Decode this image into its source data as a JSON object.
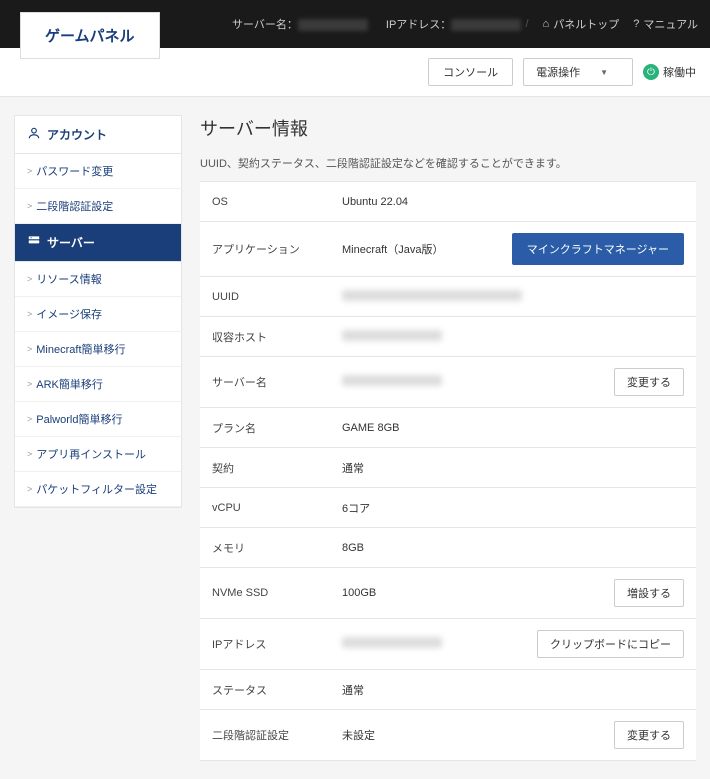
{
  "brand": "ゲームパネル",
  "topbar": {
    "server_name_label": "サーバー名：",
    "ip_label": "IPアドレス：",
    "panel_top": "パネルトップ",
    "manual": "マニュアル"
  },
  "actionbar": {
    "console": "コンソール",
    "power": "電源操作",
    "status": "稼働中"
  },
  "sidebar": {
    "sections": [
      {
        "title": "アカウント",
        "icon": "user",
        "active": false,
        "items": [
          {
            "label": "パスワード変更"
          },
          {
            "label": "二段階認証設定"
          }
        ]
      },
      {
        "title": "サーバー",
        "icon": "server",
        "active": true,
        "items": [
          {
            "label": "リソース情報"
          },
          {
            "label": "イメージ保存"
          },
          {
            "label": "Minecraft簡単移行"
          },
          {
            "label": "ARK簡単移行"
          },
          {
            "label": "Palworld簡単移行"
          },
          {
            "label": "アプリ再インストール"
          },
          {
            "label": "パケットフィルター設定"
          }
        ]
      }
    ]
  },
  "main": {
    "title": "サーバー情報",
    "description": "UUID、契約ステータス、二段階認証設定などを確認することができます。",
    "rows": [
      {
        "label": "OS",
        "value": "Ubuntu 22.04"
      },
      {
        "label": "アプリケーション",
        "value": "Minecraft（Java版）",
        "action": "マインクラフトマネージャー",
        "action_primary": true
      },
      {
        "label": "UUID",
        "blur": "wide"
      },
      {
        "label": "収容ホスト",
        "blur": "normal"
      },
      {
        "label": "サーバー名",
        "blur": "normal",
        "action": "変更する"
      },
      {
        "label": "プラン名",
        "value": "GAME 8GB"
      },
      {
        "label": "契約",
        "value": "通常"
      },
      {
        "label": "vCPU",
        "value": "6コア"
      },
      {
        "label": "メモリ",
        "value": "8GB"
      },
      {
        "label": "NVMe SSD",
        "value": "100GB",
        "action": "増設する"
      },
      {
        "label": "IPアドレス",
        "blur": "normal",
        "action": "クリップボードにコピー"
      },
      {
        "label": "ステータス",
        "value": "通常"
      },
      {
        "label": "二段階認証設定",
        "value": "未設定",
        "action": "変更する"
      }
    ]
  }
}
